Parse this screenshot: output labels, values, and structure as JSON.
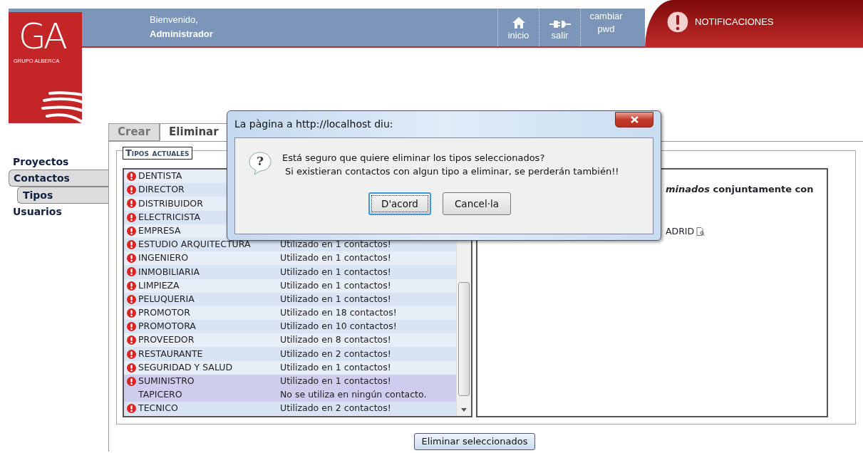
{
  "logo": {
    "initials": "GA",
    "name": "GRUPO ALBERCA"
  },
  "header": {
    "welcome": "Bienvenido,",
    "user": "Administrador",
    "nav": [
      {
        "label": "inicio"
      },
      {
        "label": "salir"
      },
      {
        "label": "cambiar pwd"
      }
    ],
    "notifications": "NOTIFICACIONES"
  },
  "sidebar": {
    "items": [
      {
        "label": "Proyectos",
        "selected": false
      },
      {
        "label": "Contactos",
        "selected": true,
        "children": [
          {
            "label": "Tipos",
            "selected": true
          }
        ]
      },
      {
        "label": "Usuarios",
        "selected": false
      }
    ]
  },
  "tabs": [
    {
      "label": "Crear",
      "selected": false
    },
    {
      "label": "Eliminar",
      "selected": true
    }
  ],
  "legend": "Tipos actuales",
  "types": [
    {
      "name": "DENTISTA",
      "in_use": true,
      "selected": false
    },
    {
      "name": "DIRECTOR",
      "in_use": true,
      "selected": false
    },
    {
      "name": "DISTRIBUIDOR",
      "in_use": true,
      "selected": false
    },
    {
      "name": "ELECTRICISTA",
      "in_use": true,
      "selected": false
    },
    {
      "name": "EMPRESA",
      "in_use": true,
      "selected": false
    },
    {
      "name": "ESTUDIO ARQUITECTURA",
      "usage": "Utilizado en 1 contactos!",
      "in_use": true,
      "selected": false
    },
    {
      "name": "INGENIERO",
      "usage": "Utilizado en 1 contactos!",
      "in_use": true,
      "selected": false
    },
    {
      "name": "INMOBILIARIA",
      "usage": "Utilizado en 1 contactos!",
      "in_use": true,
      "selected": false
    },
    {
      "name": "LIMPIEZA",
      "usage": "Utilizado en 1 contactos!",
      "in_use": true,
      "selected": false
    },
    {
      "name": "PELUQUERIA",
      "usage": "Utilizado en 1 contactos!",
      "in_use": true,
      "selected": false
    },
    {
      "name": "PROMOTOR",
      "usage": "Utilizado en 18 contactos!",
      "in_use": true,
      "selected": false
    },
    {
      "name": "PROMOTORA",
      "usage": "Utilizado en 10 contactos!",
      "in_use": true,
      "selected": false
    },
    {
      "name": "PROVEEDOR",
      "usage": "Utilizado en 8 contactos!",
      "in_use": true,
      "selected": false
    },
    {
      "name": "RESTAURANTE",
      "usage": "Utilizado en 2 contactos!",
      "in_use": true,
      "selected": false
    },
    {
      "name": "SEGURIDAD Y SALUD",
      "usage": "Utilizado en 1 contactos!",
      "in_use": true,
      "selected": false
    },
    {
      "name": "SUMINISTRO",
      "usage": "Utilizado en 1 contactos!",
      "in_use": true,
      "selected": true
    },
    {
      "name": "TAPICERO",
      "usage": "No se utiliza en ningún contacto.",
      "in_use": false,
      "selected": true
    },
    {
      "name": "TECNICO",
      "usage": "Utilizado en 2 contactos!",
      "in_use": true,
      "selected": false
    }
  ],
  "detail": {
    "heading": "*minados* conjuntamente con",
    "location": "ADRID"
  },
  "delete_button": "Eliminar seleccionados",
  "dialog": {
    "title": "La pàgina a http://localhost diu:",
    "icon": "?",
    "message": [
      "Está seguro que quiere eliminar los tipos seleccionados?",
      "Si existieran contactos con algun tipo a eliminar, se perderán también!!"
    ],
    "buttons": [
      {
        "label": "D'acord",
        "focused": true
      },
      {
        "label": "Cancel·la",
        "focused": false
      }
    ]
  }
}
